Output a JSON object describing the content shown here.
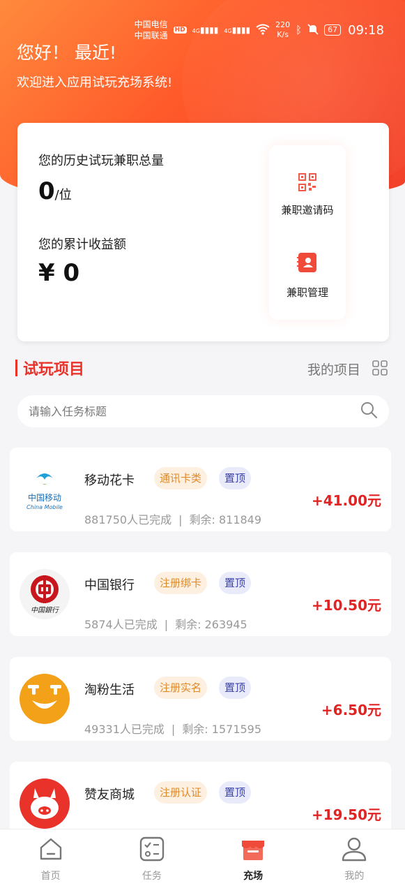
{
  "status": {
    "carrier1": "中国电信",
    "carrier2": "中国联通",
    "hd": "HD",
    "net1": "4G",
    "net2": "4G",
    "speed_value": "220",
    "speed_unit": "K/s",
    "battery": "67",
    "time": "09:18"
  },
  "header": {
    "greeting": "您好！ 最近!",
    "welcome": "欢迎进入应用试玩充场系统!"
  },
  "summary": {
    "history_label": "您的历史试玩兼职总量",
    "history_value": "0",
    "history_unit": "/位",
    "earnings_label": "您的累计收益额",
    "earnings_value": "¥ 0",
    "invite_label": "兼职邀请码",
    "manage_label": "兼职管理"
  },
  "section": {
    "title": "试玩项目",
    "my_projects": "我的项目"
  },
  "search": {
    "placeholder": "请输入任务标题"
  },
  "tasks": [
    {
      "name": "移动花卡",
      "category": "通讯卡类",
      "pin": "置顶",
      "completed": "881750人已完成",
      "remaining": "剩余: 811849",
      "reward": "+41.00元",
      "logo_text": "中国移动",
      "logo_sub": "China Mobile"
    },
    {
      "name": "中国银行",
      "category": "注册绑卡",
      "pin": "置顶",
      "completed": "5874人已完成",
      "remaining": "剩余: 263945",
      "reward": "+10.50元",
      "logo_text": "中国銀行"
    },
    {
      "name": "淘粉生活",
      "category": "注册实名",
      "pin": "置顶",
      "completed": "49331人已完成",
      "remaining": "剩余: 1571595",
      "reward": "+6.50元"
    },
    {
      "name": "赞友商城",
      "category": "注册认证",
      "pin": "置顶",
      "completed": "",
      "remaining": "",
      "reward": "+19.50元"
    }
  ],
  "tabbar": {
    "home": "首页",
    "tasks": "任务",
    "arena": "充场",
    "mine": "我的"
  },
  "colors": {
    "accent": "#e8322a",
    "reward": "#e02424",
    "hero_start": "#ff8a3d",
    "hero_end": "#f2402a"
  }
}
